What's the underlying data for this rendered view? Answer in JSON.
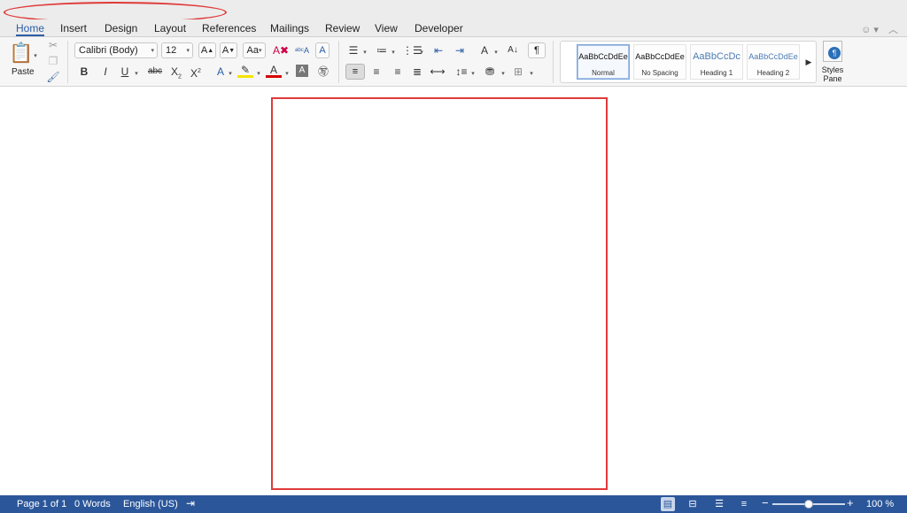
{
  "window": {
    "title": ""
  },
  "tabs": [
    {
      "label": "Home",
      "active": true
    },
    {
      "label": "Insert"
    },
    {
      "label": "Design"
    },
    {
      "label": "Layout"
    },
    {
      "label": "References"
    },
    {
      "label": "Mailings"
    },
    {
      "label": "Review"
    },
    {
      "label": "View"
    },
    {
      "label": "Developer"
    }
  ],
  "ribbon": {
    "clipboard": {
      "paste_label": "Paste"
    },
    "font": {
      "family": "Calibri (Body)",
      "size": "12"
    },
    "styles": [
      {
        "sample": "AaBbCcDdEe",
        "name": "Normal",
        "selected": true
      },
      {
        "sample": "AaBbCcDdEe",
        "name": "No Spacing"
      },
      {
        "sample": "AaBbCcDc",
        "name": "Heading 1"
      },
      {
        "sample": "AaBbCcDdEe",
        "name": "Heading 2"
      }
    ],
    "styles_pane_label": "Styles Pane"
  },
  "status": {
    "page": "Page 1 of 1",
    "words": "0 Words",
    "language": "English (US)",
    "zoom_label": "100 %",
    "zoom_value": 1.0
  },
  "colors": {
    "accent": "#2b579a",
    "tab_active": "#2a5da8",
    "annotation": "#e03a3a"
  }
}
